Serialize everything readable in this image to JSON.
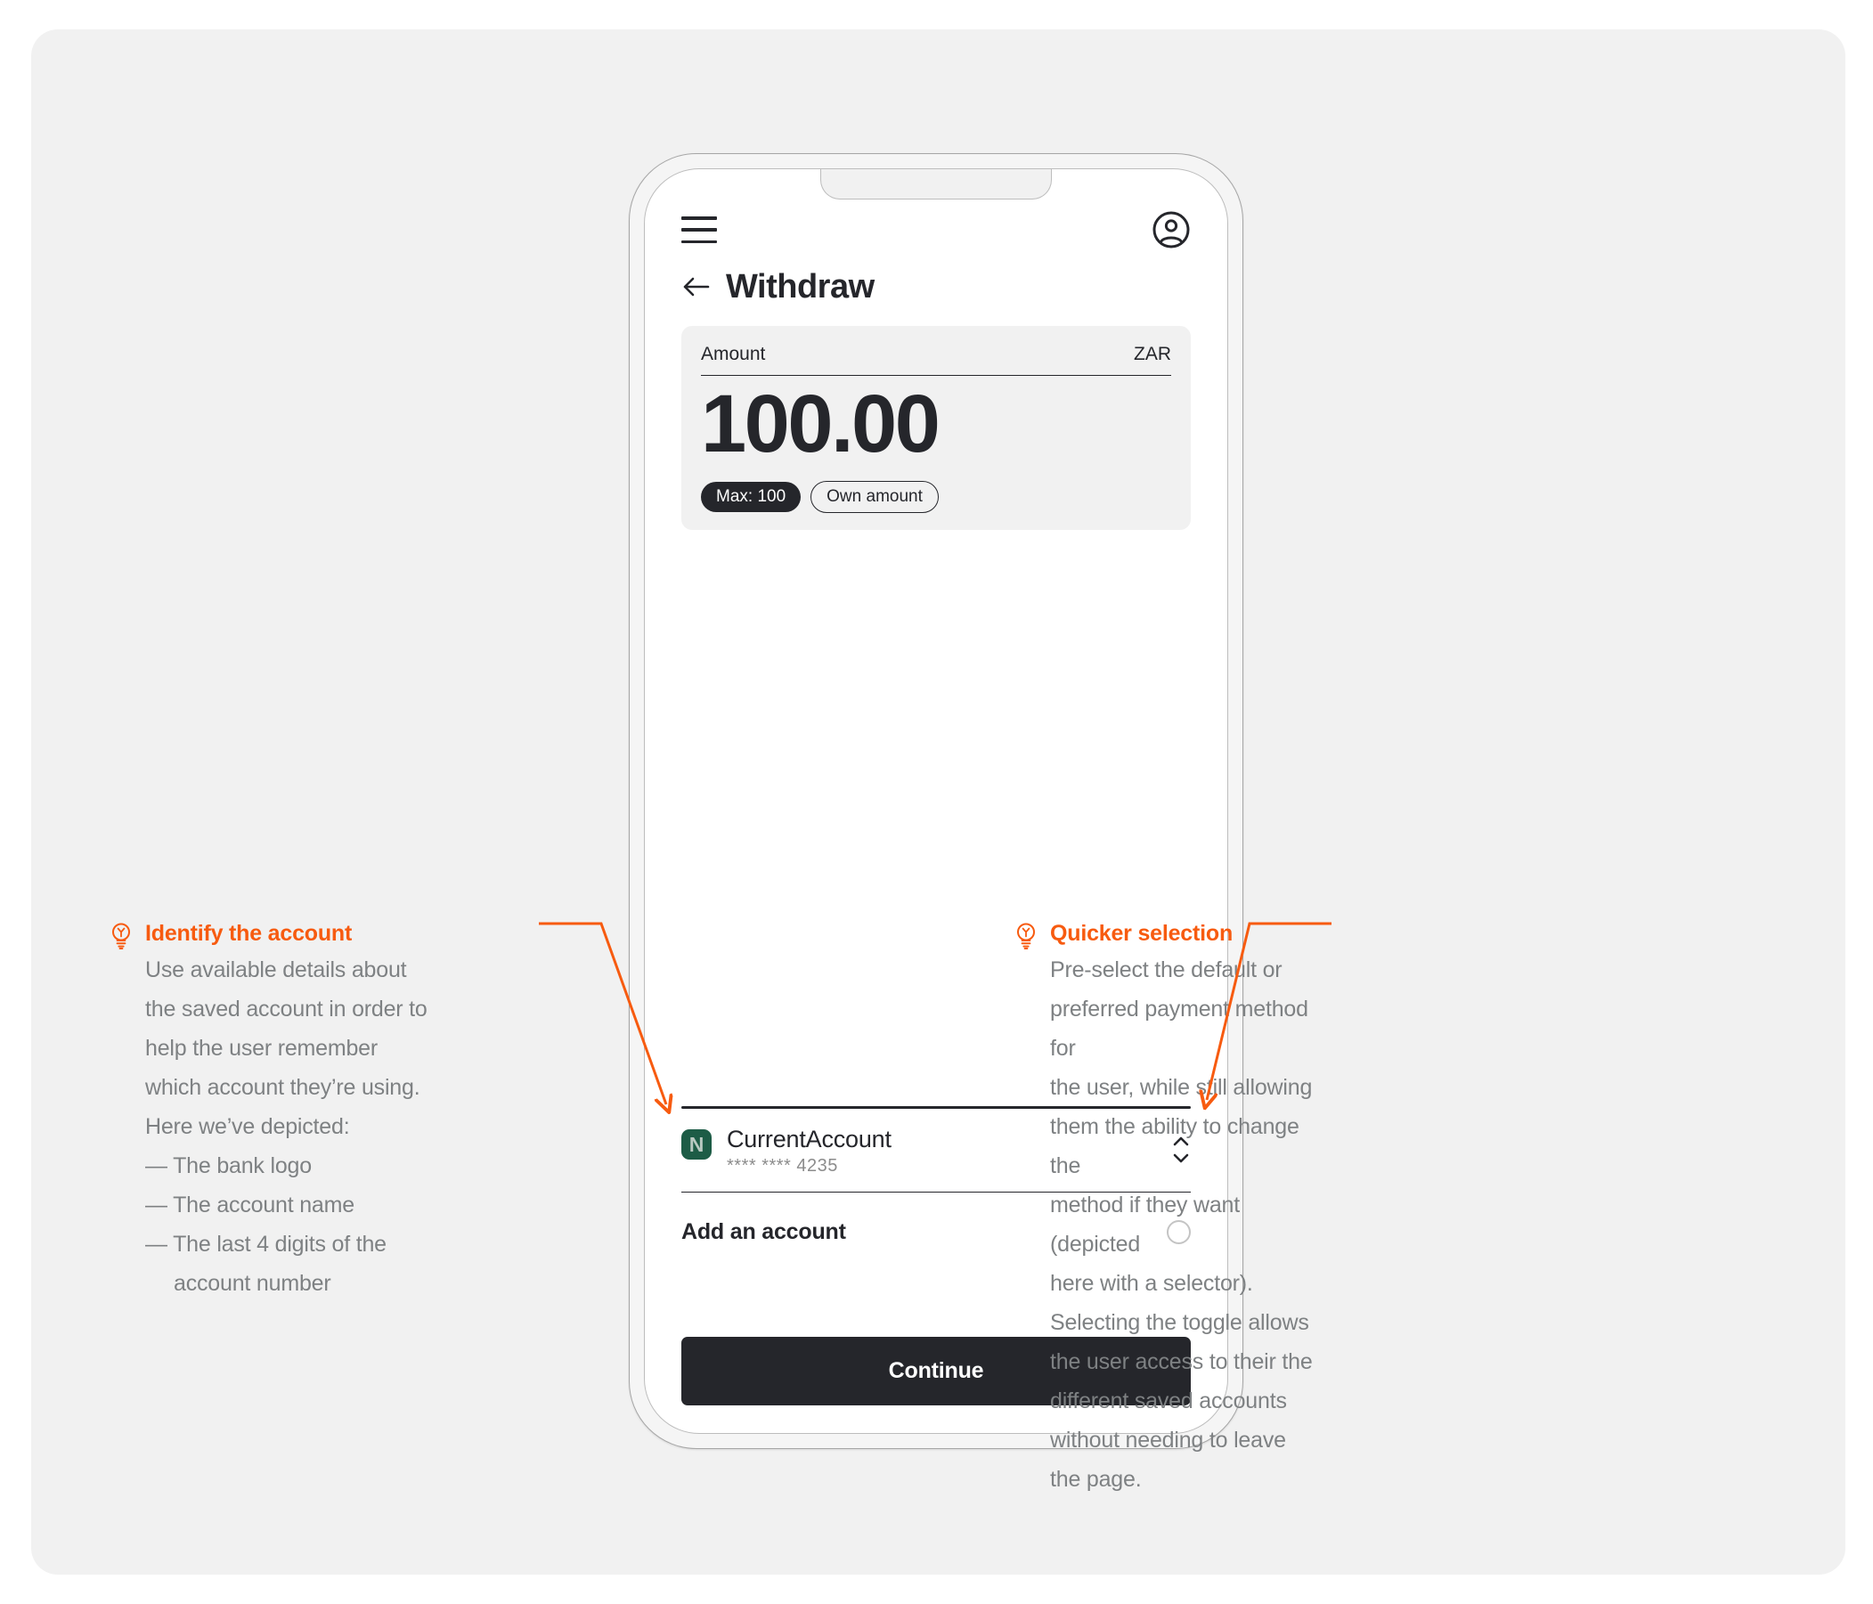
{
  "theme": {
    "page_bg": "#ffffff",
    "card_bg": "#f1f1f1",
    "accent": "#f75b10",
    "ink": "#25262b",
    "muted": "#7e8183",
    "bank_green": "#1d5c46"
  },
  "phone": {
    "topbar": {
      "menu_icon": "hamburger-menu-icon",
      "account_icon": "user-circle-icon"
    },
    "header": {
      "back_icon": "arrow-left-icon",
      "title": "Withdraw"
    },
    "amount_card": {
      "label": "Amount",
      "currency": "ZAR",
      "value": "100.00",
      "pills": [
        {
          "label": "Max: 100",
          "style": "dark"
        },
        {
          "label": "Own amount",
          "style": "outline"
        }
      ]
    },
    "account": {
      "logo_letter": "N",
      "name": "CurrentAccount",
      "number": "**** **** 4235",
      "selector_icon": "chevron-up-down-icon"
    },
    "add_account": {
      "label": "Add an account",
      "radio_icon": "radio-unselected-icon"
    },
    "cta": {
      "label": "Continue"
    }
  },
  "annotations": {
    "left": {
      "icon": "lightbulb-icon",
      "title": "Identify the account",
      "body": "Use available details about\nthe saved account in order to\nhelp the user remember\nwhich account they’re using.\nHere we’ve depicted:",
      "list": [
        "— The bank logo",
        "— The account name",
        "— The last 4 digits of the account number"
      ]
    },
    "right": {
      "icon": "lightbulb-icon",
      "title": "Quicker selection",
      "body": "Pre-select the default or\npreferred payment method for\nthe user, while still allowing\nthem the ability to change the\nmethod if they want (depicted\nhere with a selector).\nSelecting the toggle allows\nthe user access to their the\ndifferent saved accounts\nwithout needing to leave\nthe page."
    }
  }
}
